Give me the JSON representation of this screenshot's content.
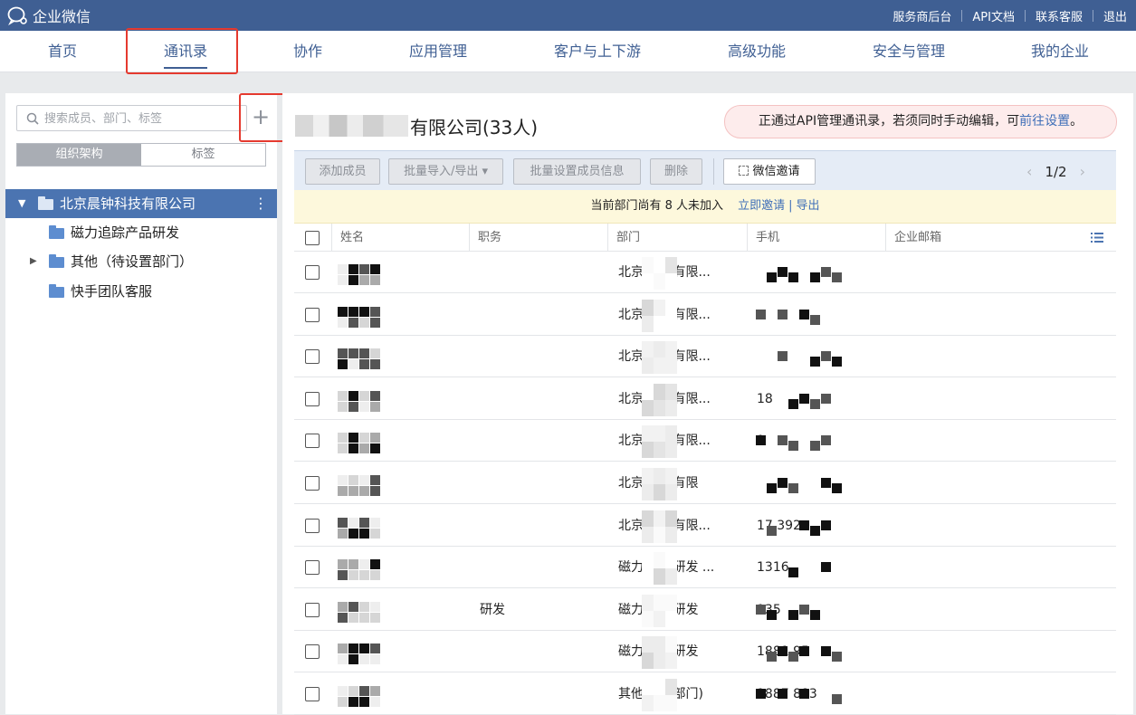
{
  "topbar": {
    "logo_text": "企业微信",
    "links": [
      "服务商后台",
      "API文档",
      "联系客服",
      "退出"
    ]
  },
  "nav": {
    "items": [
      "首页",
      "通讯录",
      "协作",
      "应用管理",
      "客户与上下游",
      "高级功能",
      "安全与管理",
      "我的企业"
    ],
    "active": "通讯录"
  },
  "sidebar": {
    "search_placeholder": "搜索成员、部门、标签",
    "add_label": "+",
    "tabs": [
      "组织架构",
      "标签"
    ],
    "active_tab": "组织架构",
    "root": "北京晨钟科技有限公司",
    "more": "⋮",
    "departments": [
      "磁力追踪产品研发",
      "其他（待设置部门）",
      "快手团队客服"
    ]
  },
  "main": {
    "company_suffix": "有限公司(33人)",
    "notice_text": "正通过API管理通讯录，若须同时手动编辑，可",
    "notice_link": "前往设置",
    "notice_end": "。",
    "toolbar": {
      "add_member": "添加成员",
      "batch_import": "批量导入/导出 ▾",
      "batch_set": "批量设置成员信息",
      "delete": "删除",
      "wechat_invite": "微信邀请"
    },
    "pager": "1/2",
    "banner": {
      "text": "当前部门尚有 8 人未加入",
      "invite": "立即邀请",
      "sep": "|",
      "export": "导出"
    },
    "columns": [
      "姓名",
      "职务",
      "部门",
      "手机",
      "企业邮箱"
    ],
    "rows": [
      {
        "title": "",
        "dept": "北京 科技有限...",
        "phone": ""
      },
      {
        "title": "",
        "dept": "北京 科技有限...",
        "phone": ""
      },
      {
        "title": "",
        "dept": "北京 科技有限...",
        "phone": ""
      },
      {
        "title": "",
        "dept": "北京 科技有限...",
        "phone": "18"
      },
      {
        "title": "",
        "dept": "北京 科技有限...",
        "phone": "1"
      },
      {
        "title": "",
        "dept": "北京 科技有限",
        "phone": ""
      },
      {
        "title": "",
        "dept": "北京 科技有限...",
        "phone": "17 392"
      },
      {
        "title": "",
        "dept": "磁力 产品研发 ...",
        "phone": "1316"
      },
      {
        "title": "研发",
        "dept": "磁力 产品研发",
        "phone": "135"
      },
      {
        "title": "",
        "dept": "磁力 产品研发",
        "phone": "1881 95"
      },
      {
        "title": "",
        "dept": "其他 设置部门)",
        "phone": "1887 883"
      }
    ]
  }
}
